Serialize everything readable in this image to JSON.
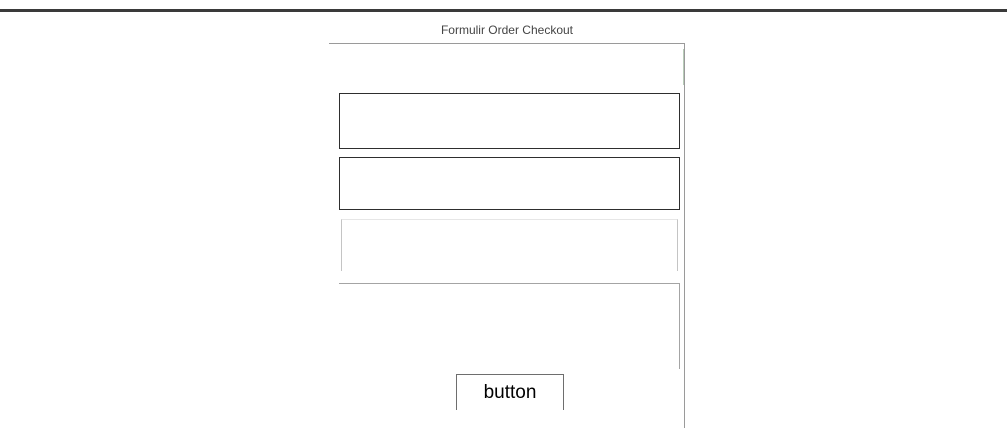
{
  "form": {
    "title": "Formulir Order Checkout",
    "fields": [
      {
        "value": "",
        "placeholder": ""
      },
      {
        "value": "",
        "placeholder": ""
      },
      {
        "value": "",
        "placeholder": ""
      },
      {
        "value": "",
        "placeholder": ""
      }
    ],
    "submit_label": "button"
  },
  "colors": {
    "top_rule": "#3a3a3a",
    "title_text": "#444444",
    "field_border": "#2e2e2e",
    "panel_border": "#9a9a9a"
  }
}
